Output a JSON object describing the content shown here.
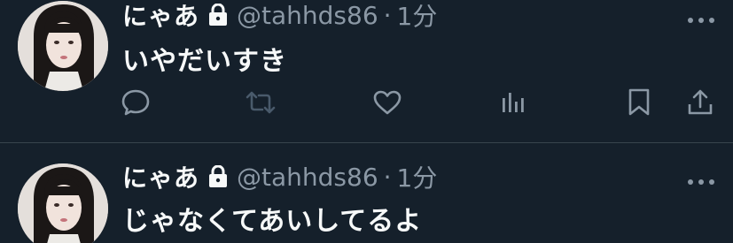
{
  "tweets": [
    {
      "name": "にゃあ",
      "handle": "@tahhds86",
      "separator": "·",
      "time": "1分",
      "text": "いやだいすき",
      "protected": true
    },
    {
      "name": "にゃあ",
      "handle": "@tahhds86",
      "separator": "·",
      "time": "1分",
      "text": "じゃなくてあいしてるよ",
      "protected": true
    }
  ],
  "icons": {
    "lock": "lock-icon",
    "more": "more-icon",
    "reply": "reply-icon",
    "retweet": "retweet-icon",
    "like": "heart-icon",
    "views": "views-icon",
    "bookmark": "bookmark-icon",
    "share": "share-icon"
  },
  "colors": {
    "background": "#15202b",
    "primary_text": "#f7f9f9",
    "secondary_text": "#8b98a5",
    "divider": "#38444d"
  }
}
